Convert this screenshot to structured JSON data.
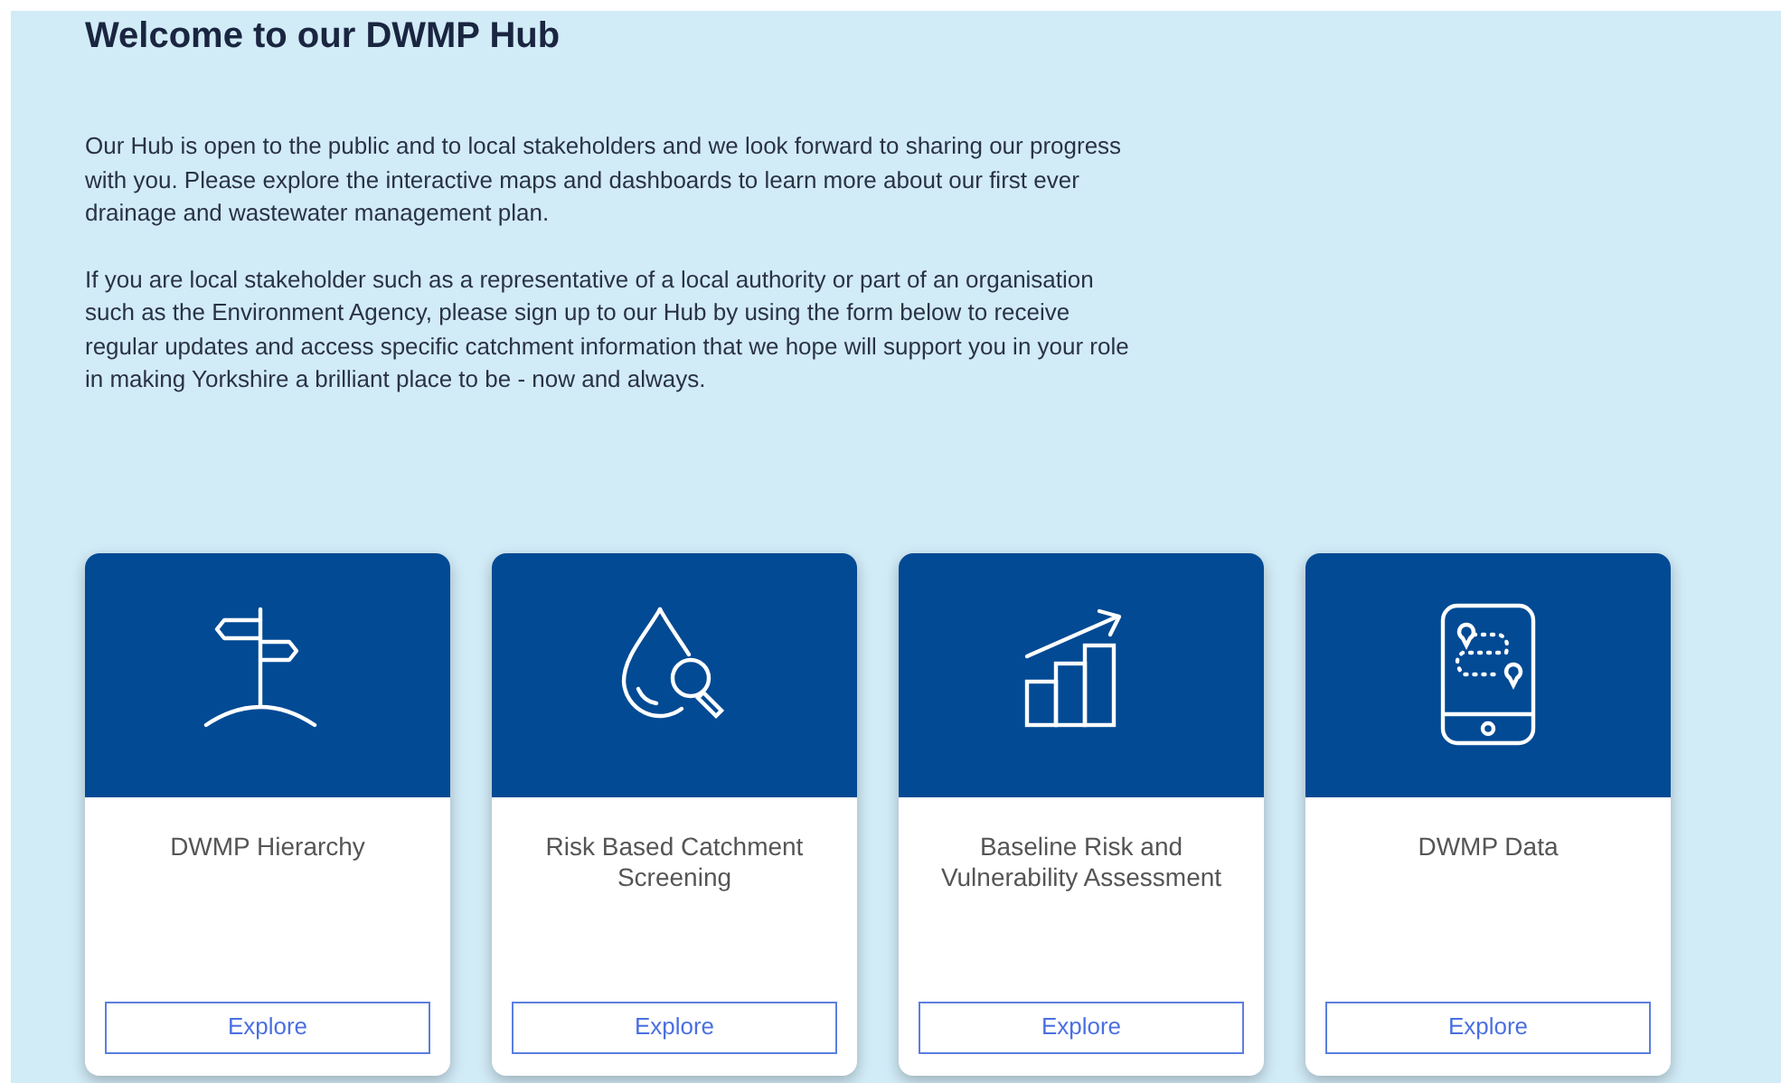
{
  "heading": "Welcome to our DWMP Hub",
  "paragraphs": [
    "Our Hub is open to the public and to local stakeholders and we look forward to sharing our progress with you.  Please explore the interactive maps and dashboards to learn more about our first ever drainage and wastewater management plan.",
    "If you are local stakeholder such as a representative of a local authority or part of an organisation such as the Environment Agency, please sign up to our Hub by using the form below to receive regular updates and access specific catchment information that we hope will support you in your role in making Yorkshire a brilliant place to be - now and always."
  ],
  "cards": [
    {
      "kind": "signpost",
      "title": "DWMP Hierarchy",
      "button": "Explore"
    },
    {
      "kind": "drop-search",
      "title": "Risk Based Catchment Screening",
      "button": "Explore"
    },
    {
      "kind": "chart",
      "title": "Baseline Risk and Vulnerability Assessment",
      "button": "Explore"
    },
    {
      "kind": "phone-route",
      "title": "DWMP Data",
      "button": "Explore"
    }
  ]
}
